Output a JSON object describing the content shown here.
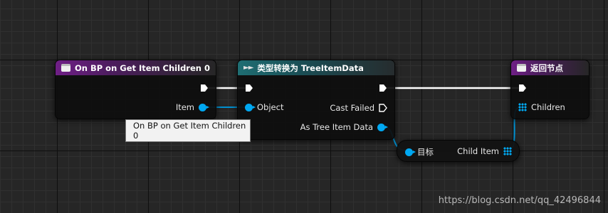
{
  "nodes": {
    "event": {
      "title": "On BP on Get Item Children 0",
      "item_label": "Item"
    },
    "cast": {
      "title": "类型转换为 TreeItemData",
      "object_label": "Object",
      "cast_failed_label": "Cast Failed",
      "as_label": "As Tree Item Data"
    },
    "getter": {
      "target_label": "目标",
      "child_item_label": "Child Item"
    },
    "return": {
      "title": "返回节点",
      "children_label": "Children"
    }
  },
  "tooltip": {
    "text": "On BP on Get Item Children 0"
  },
  "watermark": {
    "text": "https://blog.csdn.net/qq_42496844"
  },
  "colors": {
    "event_header": "#6f1f86",
    "cast_header": "#1f6e73",
    "object_pin": "#00a8f2",
    "exec_wire": "#ffffff"
  },
  "icons": {
    "event_header_icon": "event-box-icon",
    "cast_header_icon": "cast-arrow-icon",
    "return_header_icon": "return-box-icon"
  }
}
